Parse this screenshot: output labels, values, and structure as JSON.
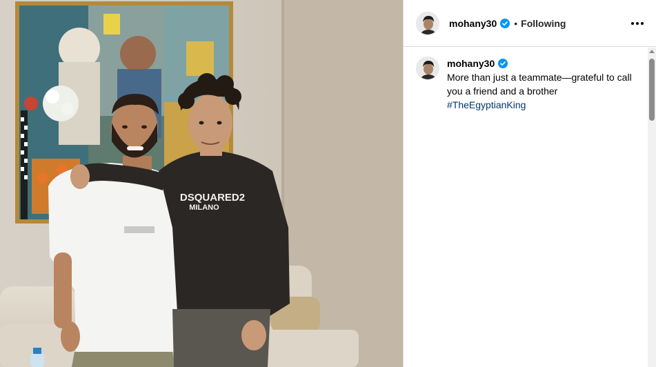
{
  "header": {
    "username": "mohany30",
    "separator": "•",
    "follow_status": "Following",
    "verified_icon": "verified-badge-icon",
    "more_icon": "more-options-icon"
  },
  "caption": {
    "username": "mohany30",
    "text": "More than just a teammate—grateful to call you a friend and a brother",
    "hashtag": "#TheEgyptianKing"
  },
  "photo": {
    "shirt_text_line1": "DSQUARED2",
    "shirt_text_line2": "MILANO"
  },
  "colors": {
    "verified_blue": "#0095f6",
    "hashtag_blue": "#00376b",
    "border": "#dbdbdb"
  }
}
